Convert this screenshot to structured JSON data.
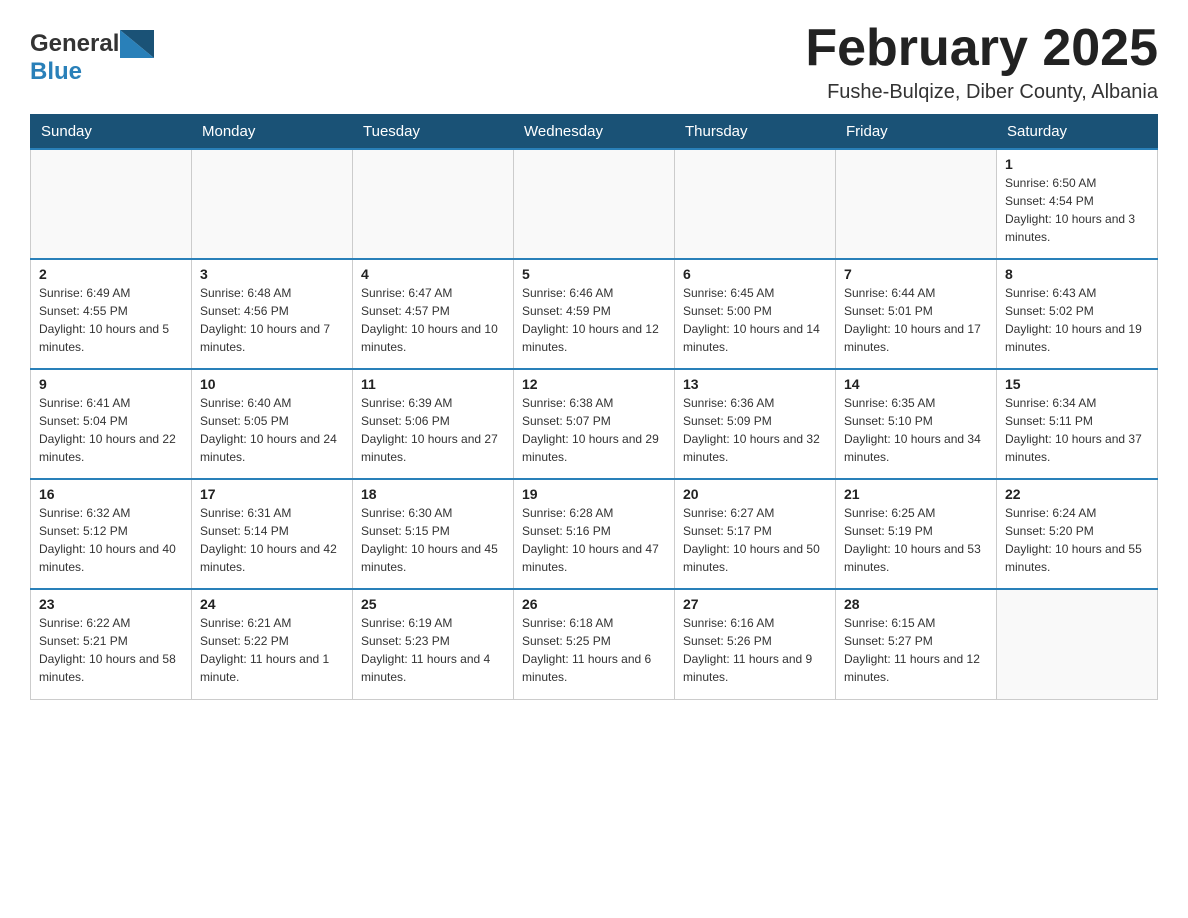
{
  "header": {
    "logo_text_general": "General",
    "logo_text_blue": "Blue",
    "title": "February 2025",
    "subtitle": "Fushe-Bulqize, Diber County, Albania"
  },
  "calendar": {
    "days_of_week": [
      "Sunday",
      "Monday",
      "Tuesday",
      "Wednesday",
      "Thursday",
      "Friday",
      "Saturday"
    ],
    "weeks": [
      [
        {
          "day": "",
          "info": ""
        },
        {
          "day": "",
          "info": ""
        },
        {
          "day": "",
          "info": ""
        },
        {
          "day": "",
          "info": ""
        },
        {
          "day": "",
          "info": ""
        },
        {
          "day": "",
          "info": ""
        },
        {
          "day": "1",
          "info": "Sunrise: 6:50 AM\nSunset: 4:54 PM\nDaylight: 10 hours and 3 minutes."
        }
      ],
      [
        {
          "day": "2",
          "info": "Sunrise: 6:49 AM\nSunset: 4:55 PM\nDaylight: 10 hours and 5 minutes."
        },
        {
          "day": "3",
          "info": "Sunrise: 6:48 AM\nSunset: 4:56 PM\nDaylight: 10 hours and 7 minutes."
        },
        {
          "day": "4",
          "info": "Sunrise: 6:47 AM\nSunset: 4:57 PM\nDaylight: 10 hours and 10 minutes."
        },
        {
          "day": "5",
          "info": "Sunrise: 6:46 AM\nSunset: 4:59 PM\nDaylight: 10 hours and 12 minutes."
        },
        {
          "day": "6",
          "info": "Sunrise: 6:45 AM\nSunset: 5:00 PM\nDaylight: 10 hours and 14 minutes."
        },
        {
          "day": "7",
          "info": "Sunrise: 6:44 AM\nSunset: 5:01 PM\nDaylight: 10 hours and 17 minutes."
        },
        {
          "day": "8",
          "info": "Sunrise: 6:43 AM\nSunset: 5:02 PM\nDaylight: 10 hours and 19 minutes."
        }
      ],
      [
        {
          "day": "9",
          "info": "Sunrise: 6:41 AM\nSunset: 5:04 PM\nDaylight: 10 hours and 22 minutes."
        },
        {
          "day": "10",
          "info": "Sunrise: 6:40 AM\nSunset: 5:05 PM\nDaylight: 10 hours and 24 minutes."
        },
        {
          "day": "11",
          "info": "Sunrise: 6:39 AM\nSunset: 5:06 PM\nDaylight: 10 hours and 27 minutes."
        },
        {
          "day": "12",
          "info": "Sunrise: 6:38 AM\nSunset: 5:07 PM\nDaylight: 10 hours and 29 minutes."
        },
        {
          "day": "13",
          "info": "Sunrise: 6:36 AM\nSunset: 5:09 PM\nDaylight: 10 hours and 32 minutes."
        },
        {
          "day": "14",
          "info": "Sunrise: 6:35 AM\nSunset: 5:10 PM\nDaylight: 10 hours and 34 minutes."
        },
        {
          "day": "15",
          "info": "Sunrise: 6:34 AM\nSunset: 5:11 PM\nDaylight: 10 hours and 37 minutes."
        }
      ],
      [
        {
          "day": "16",
          "info": "Sunrise: 6:32 AM\nSunset: 5:12 PM\nDaylight: 10 hours and 40 minutes."
        },
        {
          "day": "17",
          "info": "Sunrise: 6:31 AM\nSunset: 5:14 PM\nDaylight: 10 hours and 42 minutes."
        },
        {
          "day": "18",
          "info": "Sunrise: 6:30 AM\nSunset: 5:15 PM\nDaylight: 10 hours and 45 minutes."
        },
        {
          "day": "19",
          "info": "Sunrise: 6:28 AM\nSunset: 5:16 PM\nDaylight: 10 hours and 47 minutes."
        },
        {
          "day": "20",
          "info": "Sunrise: 6:27 AM\nSunset: 5:17 PM\nDaylight: 10 hours and 50 minutes."
        },
        {
          "day": "21",
          "info": "Sunrise: 6:25 AM\nSunset: 5:19 PM\nDaylight: 10 hours and 53 minutes."
        },
        {
          "day": "22",
          "info": "Sunrise: 6:24 AM\nSunset: 5:20 PM\nDaylight: 10 hours and 55 minutes."
        }
      ],
      [
        {
          "day": "23",
          "info": "Sunrise: 6:22 AM\nSunset: 5:21 PM\nDaylight: 10 hours and 58 minutes."
        },
        {
          "day": "24",
          "info": "Sunrise: 6:21 AM\nSunset: 5:22 PM\nDaylight: 11 hours and 1 minute."
        },
        {
          "day": "25",
          "info": "Sunrise: 6:19 AM\nSunset: 5:23 PM\nDaylight: 11 hours and 4 minutes."
        },
        {
          "day": "26",
          "info": "Sunrise: 6:18 AM\nSunset: 5:25 PM\nDaylight: 11 hours and 6 minutes."
        },
        {
          "day": "27",
          "info": "Sunrise: 6:16 AM\nSunset: 5:26 PM\nDaylight: 11 hours and 9 minutes."
        },
        {
          "day": "28",
          "info": "Sunrise: 6:15 AM\nSunset: 5:27 PM\nDaylight: 11 hours and 12 minutes."
        },
        {
          "day": "",
          "info": ""
        }
      ]
    ]
  }
}
